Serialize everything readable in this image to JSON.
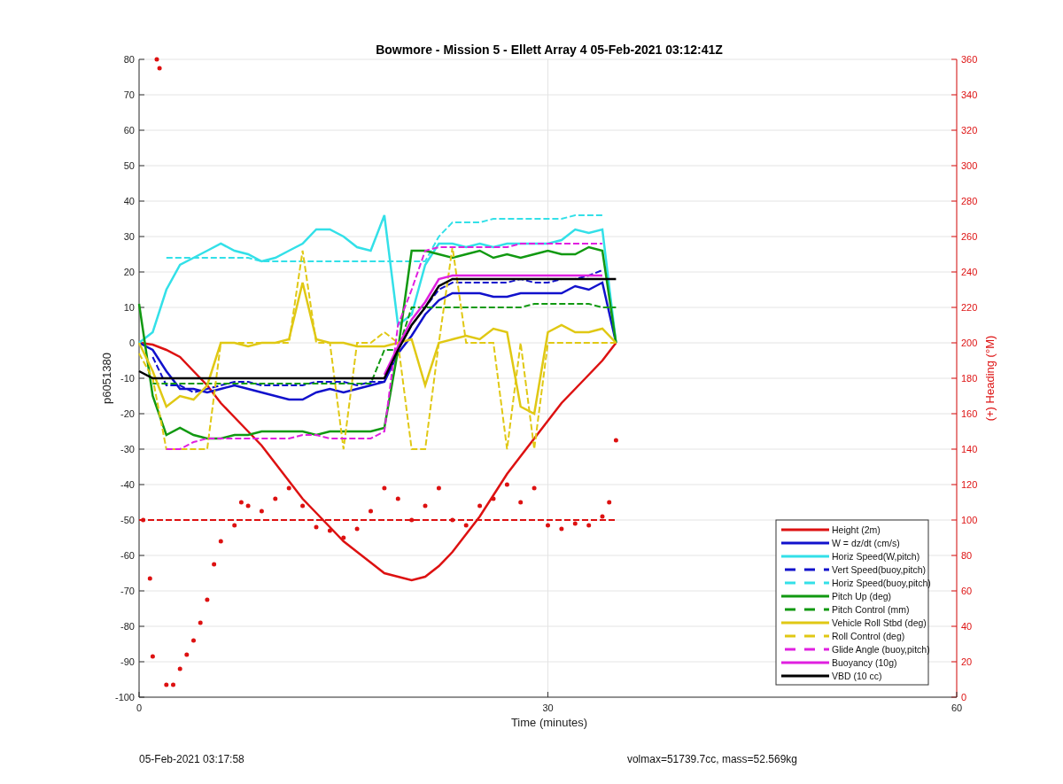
{
  "chart_data": {
    "type": "line",
    "title": "Bowmore - Mission 5 - Ellett Array 4 05-Feb-2021 03:12:41Z",
    "xlabel": "Time (minutes)",
    "ylabel": "p6051380",
    "y2label": "(+) Heading (°M)",
    "xlim": [
      0,
      60
    ],
    "ylim": [
      -100,
      80
    ],
    "y2lim": [
      0,
      360
    ],
    "xticks": [
      0,
      30,
      60
    ],
    "yticks": [
      -100,
      -90,
      -80,
      -70,
      -60,
      -50,
      -40,
      -30,
      -20,
      -10,
      0,
      10,
      20,
      30,
      40,
      50,
      60,
      70,
      80
    ],
    "y2ticks": [
      0,
      20,
      40,
      60,
      80,
      100,
      120,
      140,
      160,
      180,
      200,
      220,
      240,
      260,
      280,
      300,
      320,
      340,
      360
    ],
    "grid": true,
    "legend": "lower right",
    "x": [
      0,
      1,
      2,
      3,
      4,
      5,
      6,
      7,
      8,
      9,
      10,
      11,
      12,
      13,
      14,
      15,
      16,
      17,
      18,
      19,
      20,
      21,
      22,
      23,
      24,
      25,
      26,
      27,
      28,
      29,
      30,
      31,
      32,
      33,
      34,
      35
    ],
    "series": [
      {
        "name": "Height (2m)",
        "color": "#dd1111",
        "values": [
          0,
          -0.5,
          -2,
          -4,
          -8,
          -12,
          -17,
          -21,
          -25,
          -29,
          -34,
          -39,
          -44,
          -48,
          -52,
          -56,
          -59,
          -62,
          -65,
          -66,
          -67,
          -66,
          -63,
          -59,
          -54,
          -49,
          -43,
          -37,
          -32,
          -27,
          -22,
          -17,
          -13,
          -9,
          -5,
          0
        ]
      },
      {
        "name": "W = dz/dt (cm/s)",
        "color": "#1111cc",
        "values": [
          0,
          -2,
          -8,
          -13,
          -13,
          -14,
          -13,
          -12,
          -13,
          -14,
          -15,
          -16,
          -16,
          -14,
          -13,
          -14,
          -13,
          -12,
          -11,
          -3,
          2,
          8,
          12,
          14,
          14,
          14,
          13,
          13,
          14,
          14,
          14,
          14,
          16,
          15,
          17,
          0
        ]
      },
      {
        "name": "Horiz Speed(W,pitch)",
        "color": "#33e0e8",
        "values": [
          0,
          3,
          15,
          22,
          24,
          26,
          28,
          26,
          25,
          23,
          24,
          26,
          28,
          32,
          32,
          30,
          27,
          26,
          36,
          5,
          8,
          22,
          28,
          28,
          27,
          28,
          27,
          28,
          28,
          28,
          28,
          29,
          32,
          31,
          32,
          0
        ]
      },
      {
        "name": "Vert Speed(buoy,pitch)",
        "color": "#1111cc",
        "line_style": "dashed",
        "values": [
          null,
          -4,
          -12,
          -12,
          -14,
          -13,
          -12,
          -11,
          -11,
          -12,
          -12,
          -12,
          -12,
          -11,
          -11,
          -11,
          -12,
          -11,
          -11,
          -2,
          5,
          10,
          15,
          17,
          17,
          17,
          17,
          17,
          18,
          17,
          17,
          18,
          18,
          19,
          20.5,
          null
        ]
      },
      {
        "name": "Horiz Speed(buoy,pitch)",
        "color": "#33e0e8",
        "line_style": "dashed",
        "values": [
          null,
          null,
          24,
          24,
          24,
          24,
          24,
          24,
          24,
          23,
          23,
          23,
          23,
          23,
          23,
          23,
          23,
          23,
          23,
          23,
          23,
          23,
          30,
          34,
          34,
          34,
          35,
          35,
          35,
          35,
          35,
          35,
          36,
          36,
          36,
          null
        ]
      },
      {
        "name": "Pitch Up (deg)",
        "color": "#119911",
        "values": [
          11,
          -15,
          -26,
          -24,
          -26,
          -27,
          -27,
          -26,
          -26,
          -25,
          -25,
          -25,
          -25,
          -26,
          -25,
          -25,
          -25,
          -25,
          -24,
          -2,
          26,
          26,
          25,
          24,
          25,
          26,
          24,
          25,
          24,
          25,
          26,
          25,
          25,
          27,
          26,
          0
        ]
      },
      {
        "name": "Pitch Control (mm)",
        "color": "#119911",
        "line_style": "dashed",
        "values": [
          null,
          -11.5,
          -11.5,
          -11.5,
          -11.5,
          -11.5,
          -11.5,
          -11.5,
          -11.5,
          -11.5,
          -11.5,
          -11.5,
          -11.5,
          -11.5,
          -11.5,
          -11.5,
          -11.5,
          -11.5,
          -2,
          -2,
          10,
          10,
          10,
          10,
          10,
          10,
          10,
          10,
          10,
          11,
          11,
          11,
          11,
          11,
          10,
          10
        ]
      },
      {
        "name": "Vehicle Roll Stbd (deg)",
        "color": "#e0c814",
        "values": [
          0,
          -8,
          -18,
          -15,
          -16,
          -12,
          0,
          0,
          -1,
          0,
          0,
          1,
          17,
          1,
          0,
          0,
          -1,
          -1,
          -1,
          0,
          1,
          -12,
          0,
          1,
          2,
          1,
          4,
          3,
          -18,
          -20,
          3,
          5,
          3,
          3,
          4,
          0
        ]
      },
      {
        "name": "Roll Control (deg)",
        "color": "#e0c814",
        "line_style": "dashed",
        "values": [
          -3,
          -10,
          -30,
          -30,
          -30,
          -30,
          0,
          0,
          0,
          0,
          0,
          0,
          26,
          0,
          0,
          -30,
          0,
          0,
          3,
          0,
          -30,
          -30,
          0,
          27,
          0,
          0,
          0,
          -30,
          0,
          -30,
          0,
          0,
          0,
          0,
          0,
          0
        ]
      },
      {
        "name": "Glide Angle (buoy,pitch)",
        "color": "#e020e0",
        "line_style": "dashed",
        "values": [
          null,
          null,
          -30,
          -30,
          -28,
          -27,
          -27,
          -27,
          -27,
          -27,
          -27,
          -27,
          -26,
          -26,
          -27,
          -27,
          -27,
          -27,
          -25,
          5,
          15,
          26,
          27,
          27,
          27,
          27,
          27,
          27,
          28,
          28,
          28,
          28,
          28,
          28,
          28,
          null
        ]
      },
      {
        "name": "Buoyancy (10g)",
        "color": "#e020e0",
        "values": [
          null,
          null,
          null,
          null,
          null,
          null,
          null,
          null,
          null,
          null,
          null,
          null,
          null,
          null,
          null,
          null,
          null,
          null,
          -9,
          -1,
          6.5,
          11.5,
          18,
          19,
          19,
          19,
          19,
          19,
          19,
          19,
          19,
          19,
          19,
          19,
          19,
          null
        ]
      },
      {
        "name": "VBD (10 cc)",
        "color": "#000000",
        "values": [
          -8,
          -10,
          -10,
          -10,
          -10,
          -10,
          -10,
          -10,
          -10,
          -10,
          -10,
          -10,
          -10,
          -10,
          -10,
          -10,
          -10,
          -10,
          -10,
          -2,
          5,
          10,
          16,
          18,
          18,
          18,
          18,
          18,
          18,
          18,
          18,
          18,
          18,
          18,
          18,
          18
        ]
      },
      {
        "color": "#dd1111",
        "line_style": "dashed",
        "axis": "y2",
        "x": [
          0,
          35
        ],
        "values": [
          100,
          100
        ]
      },
      {
        "color": "#dd1111",
        "type": "scatter",
        "axis": "y2",
        "x": [
          0.3,
          0.8,
          1,
          1.3,
          1.5,
          2,
          2.5,
          3,
          3.5,
          4,
          4.5,
          5,
          5.5,
          6,
          7,
          7.5,
          8,
          9,
          10,
          11,
          12,
          13,
          14,
          15,
          16,
          17,
          18,
          19,
          20,
          21,
          22,
          23,
          24,
          25,
          26,
          27,
          28,
          29,
          30,
          31,
          32,
          33,
          34,
          34.5,
          35
        ],
        "values": [
          100,
          67,
          23,
          360,
          355,
          7,
          7,
          16,
          24,
          32,
          42,
          55,
          75,
          88,
          97,
          110,
          108,
          105,
          112,
          118,
          108,
          96,
          94,
          90,
          95,
          105,
          118,
          112,
          100,
          108,
          118,
          100,
          97,
          108,
          112,
          120,
          110,
          118,
          97,
          95,
          98,
          97,
          102,
          110,
          145
        ]
      }
    ]
  },
  "footer": {
    "timestamp": "05-Feb-2021 03:17:58",
    "summary": "volmax=51739.7cc, mass=52.569kg"
  }
}
